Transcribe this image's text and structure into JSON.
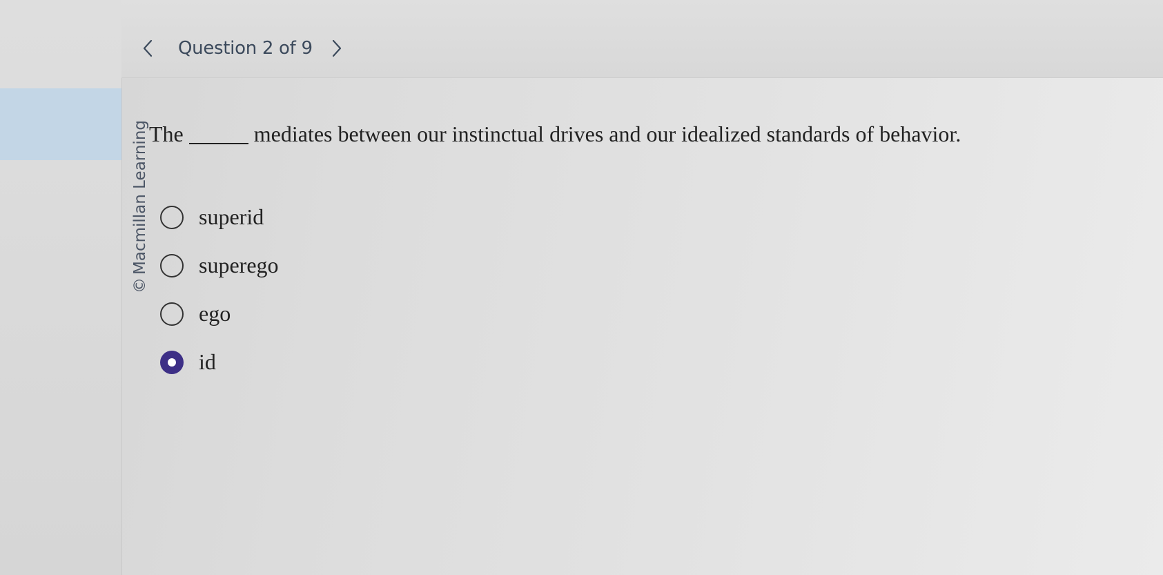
{
  "header": {
    "question_counter": "Question 2 of 9"
  },
  "copyright": {
    "symbol": "©",
    "text": "Macmillan Learning"
  },
  "question": {
    "prefix": "The",
    "suffix": "mediates between our instinctual drives and our idealized standards of behavior."
  },
  "options": [
    {
      "label": "superid",
      "selected": false
    },
    {
      "label": "superego",
      "selected": false
    },
    {
      "label": "ego",
      "selected": false
    },
    {
      "label": "id",
      "selected": true
    }
  ],
  "colors": {
    "selected_radio": "#3d2f86",
    "counter_text": "#3c4a5c",
    "rail_highlight": "#c3d6e6"
  },
  "icons": {
    "prev": "chevron-left-icon",
    "next": "chevron-right-icon"
  }
}
